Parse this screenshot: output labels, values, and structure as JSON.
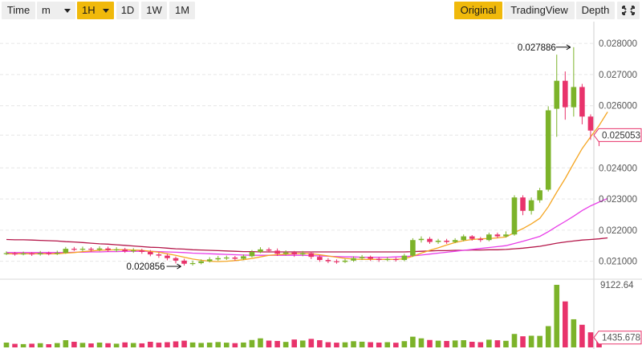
{
  "toolbar": {
    "time_label": "Time",
    "minute_label": "m",
    "hour_label": "1H",
    "day_label": "1D",
    "week_label": "1W",
    "month_label": "1M",
    "original_label": "Original",
    "tradingview_label": "TradingView",
    "depth_label": "Depth",
    "fullscreen_icon": "fullscreen-icon"
  },
  "colors": {
    "up": "#7cb32a",
    "down": "#e8336b",
    "ma_fast": "#f5a623",
    "ma_mid": "#e83ee8",
    "ma_slow": "#b5174a",
    "accent": "#f0b90b",
    "grid": "#e6e6e6"
  },
  "chart_data": {
    "type": "candlestick",
    "price_axis": {
      "ticks": [
        "0.028000",
        "0.027000",
        "0.026000",
        "0.025053",
        "0.024000",
        "0.023000",
        "0.022000",
        "0.021000"
      ],
      "range": [
        0.0205,
        0.0287
      ]
    },
    "last_price": "0.025053",
    "annotations": {
      "high": "0.027886",
      "low": "0.020856"
    },
    "volume_axis": {
      "max_label": "9122.64",
      "last_label": "1435.678",
      "max": 9122.64
    },
    "candles": [
      [
        0.02124,
        0.02126,
        0.0212,
        0.02132
      ],
      [
        0.02125,
        0.02123,
        0.02118,
        0.0213
      ],
      [
        0.02123,
        0.02125,
        0.02119,
        0.02131
      ],
      [
        0.02125,
        0.02122,
        0.02117,
        0.02129
      ],
      [
        0.02122,
        0.02126,
        0.02118,
        0.02133
      ],
      [
        0.02126,
        0.02124,
        0.02119,
        0.02131
      ],
      [
        0.02124,
        0.02127,
        0.0212,
        0.02134
      ],
      [
        0.02127,
        0.0214,
        0.02124,
        0.02146
      ],
      [
        0.0214,
        0.02138,
        0.02133,
        0.02146
      ],
      [
        0.02138,
        0.0214,
        0.02132,
        0.02147
      ],
      [
        0.0214,
        0.02137,
        0.02131,
        0.02145
      ],
      [
        0.02137,
        0.02141,
        0.02132,
        0.02148
      ],
      [
        0.02141,
        0.02136,
        0.0213,
        0.02147
      ],
      [
        0.02136,
        0.02138,
        0.0213,
        0.02145
      ],
      [
        0.02138,
        0.02132,
        0.02127,
        0.02143
      ],
      [
        0.02132,
        0.02135,
        0.02127,
        0.02142
      ],
      [
        0.02135,
        0.0213,
        0.02124,
        0.0214
      ],
      [
        0.0213,
        0.02122,
        0.02116,
        0.02136
      ],
      [
        0.02122,
        0.02118,
        0.02111,
        0.02128
      ],
      [
        0.02118,
        0.0211,
        0.02103,
        0.02124
      ],
      [
        0.0211,
        0.02102,
        0.02093,
        0.02115
      ],
      [
        0.02102,
        0.02092,
        0.02086,
        0.02108
      ],
      [
        0.02092,
        0.02094,
        0.02086,
        0.02102
      ],
      [
        0.02094,
        0.021,
        0.0209,
        0.02106
      ],
      [
        0.021,
        0.02106,
        0.02096,
        0.02113
      ],
      [
        0.02106,
        0.0211,
        0.02101,
        0.02117
      ],
      [
        0.0211,
        0.02112,
        0.02104,
        0.02118
      ],
      [
        0.02112,
        0.02108,
        0.02101,
        0.02117
      ],
      [
        0.02108,
        0.02116,
        0.02104,
        0.02122
      ],
      [
        0.02116,
        0.0213,
        0.02112,
        0.02136
      ],
      [
        0.0213,
        0.02138,
        0.02126,
        0.02145
      ],
      [
        0.02138,
        0.02134,
        0.02128,
        0.02144
      ],
      [
        0.02134,
        0.02124,
        0.02117,
        0.02141
      ],
      [
        0.02124,
        0.02128,
        0.02118,
        0.02135
      ],
      [
        0.02128,
        0.02122,
        0.02114,
        0.02133
      ],
      [
        0.02122,
        0.02126,
        0.02116,
        0.02133
      ],
      [
        0.02126,
        0.02114,
        0.02107,
        0.02131
      ],
      [
        0.02114,
        0.02104,
        0.02098,
        0.0212
      ],
      [
        0.02104,
        0.021,
        0.02094,
        0.0211
      ],
      [
        0.021,
        0.02098,
        0.02092,
        0.02106
      ],
      [
        0.02098,
        0.02102,
        0.02094,
        0.02108
      ],
      [
        0.02102,
        0.0211,
        0.02098,
        0.02116
      ],
      [
        0.0211,
        0.02114,
        0.02104,
        0.0212
      ],
      [
        0.02114,
        0.02108,
        0.02101,
        0.02118
      ],
      [
        0.02108,
        0.02104,
        0.02098,
        0.02113
      ],
      [
        0.02104,
        0.02107,
        0.021,
        0.02113
      ],
      [
        0.02107,
        0.02104,
        0.02099,
        0.02112
      ],
      [
        0.02104,
        0.02118,
        0.021,
        0.02124
      ],
      [
        0.02118,
        0.02168,
        0.02114,
        0.02174
      ],
      [
        0.02168,
        0.02172,
        0.0216,
        0.0218
      ],
      [
        0.02172,
        0.02162,
        0.02156,
        0.02178
      ],
      [
        0.02162,
        0.02166,
        0.02156,
        0.02172
      ],
      [
        0.02166,
        0.02162,
        0.02156,
        0.02172
      ],
      [
        0.02162,
        0.02168,
        0.02158,
        0.02174
      ],
      [
        0.02168,
        0.0218,
        0.02164,
        0.02186
      ],
      [
        0.0218,
        0.02172,
        0.02166,
        0.02184
      ],
      [
        0.02172,
        0.02168,
        0.02162,
        0.02178
      ],
      [
        0.02168,
        0.02186,
        0.02164,
        0.02192
      ],
      [
        0.02186,
        0.0218,
        0.02174,
        0.02192
      ],
      [
        0.0218,
        0.02186,
        0.02176,
        0.02196
      ],
      [
        0.02186,
        0.02305,
        0.02182,
        0.02312
      ],
      [
        0.02305,
        0.02262,
        0.02248,
        0.02312
      ],
      [
        0.02262,
        0.02296,
        0.0225,
        0.02305
      ],
      [
        0.02296,
        0.02328,
        0.02288,
        0.02336
      ],
      [
        0.0233,
        0.02585,
        0.02324,
        0.02598
      ],
      [
        0.0259,
        0.0268,
        0.025,
        0.02764
      ],
      [
        0.0268,
        0.02595,
        0.02555,
        0.0271
      ],
      [
        0.02595,
        0.0266,
        0.02565,
        0.02788
      ],
      [
        0.0266,
        0.02565,
        0.0254,
        0.0267
      ],
      [
        0.02565,
        0.0252,
        0.0249,
        0.02572
      ],
      [
        0.0252,
        0.02505,
        0.0247,
        0.02525
      ]
    ],
    "volumes": [
      700,
      520,
      480,
      540,
      610,
      470,
      630,
      1050,
      820,
      660,
      580,
      700,
      610,
      540,
      730,
      640,
      590,
      820,
      690,
      760,
      880,
      980,
      720,
      650,
      700,
      780,
      690,
      620,
      710,
      1080,
      1320,
      990,
      940,
      800,
      1150,
      1000,
      1240,
      1050,
      760,
      690,
      740,
      900,
      830,
      760,
      700,
      760,
      680,
      910,
      1560,
      1320,
      1080,
      980,
      940,
      1010,
      1050,
      820,
      760,
      1120,
      1040,
      960,
      1960,
      1620,
      1700,
      1680,
      3100,
      9122.64,
      6700,
      4100,
      3300,
      2200,
      1435.678
    ],
    "ma_fast": [
      0.02124,
      0.02124,
      0.02124,
      0.02124,
      0.02124,
      0.02124,
      0.02124,
      0.02126,
      0.02128,
      0.02131,
      0.02133,
      0.02135,
      0.02136,
      0.02137,
      0.02137,
      0.02136,
      0.02135,
      0.02132,
      0.02129,
      0.02124,
      0.02119,
      0.02113,
      0.02107,
      0.02103,
      0.021,
      0.02099,
      0.021,
      0.02102,
      0.02105,
      0.02109,
      0.02114,
      0.02119,
      0.02121,
      0.02123,
      0.02124,
      0.02125,
      0.02124,
      0.02121,
      0.02117,
      0.02113,
      0.02109,
      0.02107,
      0.02106,
      0.02106,
      0.02106,
      0.02106,
      0.02106,
      0.02108,
      0.02116,
      0.02126,
      0.02135,
      0.02143,
      0.02152,
      0.0216,
      0.02166,
      0.0217,
      0.02172,
      0.02173,
      0.02175,
      0.02178,
      0.02192,
      0.02205,
      0.0222,
      0.02238,
      0.02275,
      0.02322,
      0.02366,
      0.02415,
      0.02462,
      0.025,
      0.02536,
      0.0258
    ],
    "ma_mid": [
      0.02128,
      0.02128,
      0.02128,
      0.02128,
      0.02128,
      0.02128,
      0.02128,
      0.02128,
      0.02129,
      0.02129,
      0.0213,
      0.0213,
      0.02131,
      0.02131,
      0.02132,
      0.02132,
      0.02132,
      0.02132,
      0.02131,
      0.0213,
      0.02129,
      0.02128,
      0.02126,
      0.02125,
      0.02124,
      0.02123,
      0.02122,
      0.02121,
      0.0212,
      0.02119,
      0.02119,
      0.02119,
      0.02119,
      0.02119,
      0.02119,
      0.02119,
      0.02118,
      0.02117,
      0.02116,
      0.02115,
      0.02114,
      0.02114,
      0.02113,
      0.02113,
      0.02113,
      0.02113,
      0.02114,
      0.02115,
      0.02117,
      0.0212,
      0.02123,
      0.02126,
      0.02129,
      0.02132,
      0.02135,
      0.02138,
      0.02141,
      0.02144,
      0.02147,
      0.0215,
      0.02157,
      0.02164,
      0.02172,
      0.0218,
      0.02195,
      0.02212,
      0.02228,
      0.02245,
      0.02263,
      0.02278,
      0.0229,
      0.02302
    ],
    "ma_slow": [
      0.0217,
      0.02169,
      0.02169,
      0.02168,
      0.02167,
      0.02166,
      0.02165,
      0.02163,
      0.02162,
      0.0216,
      0.02158,
      0.02156,
      0.02155,
      0.02153,
      0.02151,
      0.02149,
      0.02147,
      0.02145,
      0.02144,
      0.02142,
      0.0214,
      0.02139,
      0.02137,
      0.02136,
      0.02135,
      0.02134,
      0.02133,
      0.02132,
      0.02131,
      0.02131,
      0.0213,
      0.0213,
      0.0213,
      0.0213,
      0.0213,
      0.0213,
      0.0213,
      0.0213,
      0.0213,
      0.0213,
      0.0213,
      0.0213,
      0.0213,
      0.0213,
      0.0213,
      0.0213,
      0.0213,
      0.0213,
      0.02131,
      0.02132,
      0.02133,
      0.02134,
      0.02134,
      0.02135,
      0.02135,
      0.02136,
      0.02136,
      0.02137,
      0.02137,
      0.02138,
      0.0214,
      0.02142,
      0.02145,
      0.02148,
      0.02153,
      0.02158,
      0.02162,
      0.02165,
      0.02168,
      0.0217,
      0.02172,
      0.02175
    ]
  }
}
